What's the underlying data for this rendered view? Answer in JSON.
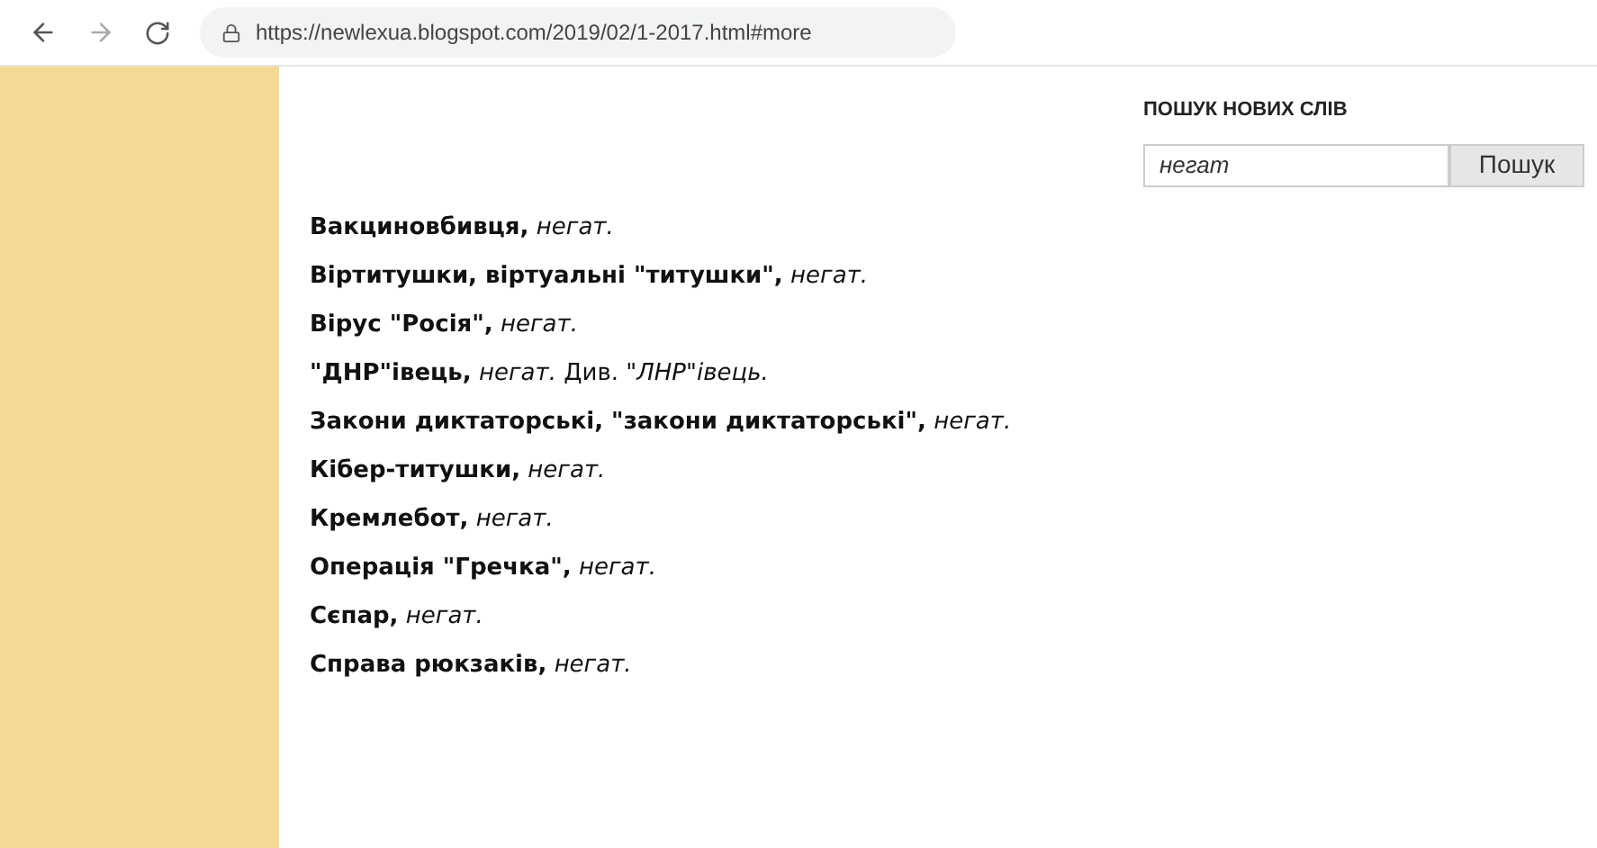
{
  "browser": {
    "url": "https://newlexua.blogspot.com/2019/02/1-2017.html#more"
  },
  "search": {
    "title": "ПОШУК НОВИХ СЛІВ",
    "value": "негат",
    "button": "Пошук"
  },
  "entries": [
    "**Вакциновбивця,** *негат.*",
    "**Віртитушки, віртуальні \"титушки\",** *негат.*",
    "**Вірус \"Росія\",** *негат.*",
    "**\"ДНР\"івець,** *негат.* Див. *\"ЛНР\"івець.*",
    "**Закони диктаторські, \"закони диктаторські\",** *негат.*",
    "**Кібер-титушки,** *негат.*",
    "**Кремлебот,** *негат.*",
    "**Операція \"Гречка\",** *негат.*",
    "**Сєпар,** *негат.*",
    "**Справа рюкзаків,** *негат.*"
  ]
}
